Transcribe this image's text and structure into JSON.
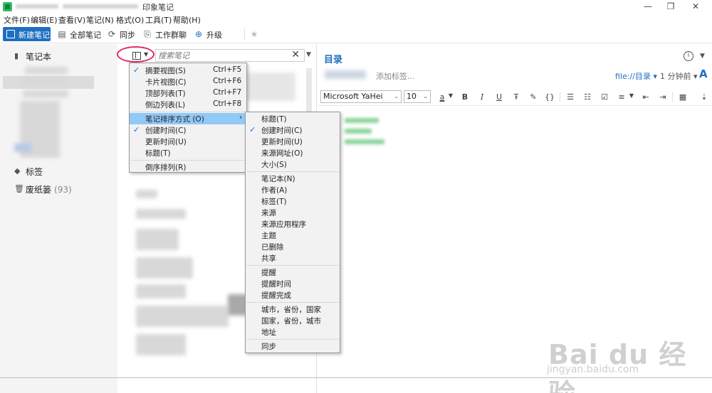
{
  "window": {
    "title": "印象笔记",
    "controls": {
      "minimize": "—",
      "restore": "❐",
      "close": "✕"
    }
  },
  "menubar": [
    "文件(F)",
    "编辑(E)",
    "查看(V)",
    "笔记(N)",
    "格式(O)",
    "工具(T)",
    "帮助(H)"
  ],
  "toolbar": {
    "new_note": "新建笔记",
    "all_notes": "全部笔记",
    "sync": "同步",
    "work_chat": "工作群聊",
    "upgrade": "升级"
  },
  "sidebar": {
    "notebooks": "笔记本",
    "tags": "标签",
    "trash": "废纸篓",
    "trash_count": "(93)"
  },
  "list": {
    "search_placeholder": "搜索笔记"
  },
  "editor": {
    "title": "目录",
    "add_tag": "添加标签...",
    "link": "file://目录 ▾",
    "time": "1 分钟前 ▾",
    "font": "Microsoft YaHei",
    "size": "10",
    "text_color": "a"
  },
  "view_menu": {
    "items": [
      {
        "label": "摘要视图(S)",
        "shortcut": "Ctrl+F5",
        "checked": "✓"
      },
      {
        "label": "卡片视图(C)",
        "shortcut": "Ctrl+F6"
      },
      {
        "label": "顶部列表(T)",
        "shortcut": "Ctrl+F7"
      },
      {
        "label": "侧边列表(L)",
        "shortcut": "Ctrl+F8"
      }
    ],
    "sort_by": "笔记排序方式 (O)",
    "sort_items": [
      {
        "label": "创建时间(C)",
        "checked": "✓"
      },
      {
        "label": "更新时间(U)"
      },
      {
        "label": "标题(T)"
      }
    ],
    "reverse": "倒序排列(R)"
  },
  "sort_submenu": {
    "items": [
      "标题(T)",
      "创建时间(C)",
      "更新时间(U)",
      "来源网址(O)",
      "大小(S)",
      "笔记本(N)",
      "作者(A)",
      "标签(T)",
      "来源",
      "来源应用程序",
      "主题",
      "已删除",
      "共享",
      "提醒",
      "提醒时间",
      "提醒完成",
      "城市，省份，国家",
      "国家，省份，城市",
      "地址",
      "同步"
    ],
    "checked_mark": "✓"
  },
  "watermark": {
    "logo": "Bai du 经验",
    "url": "jingyan.baidu.com"
  }
}
